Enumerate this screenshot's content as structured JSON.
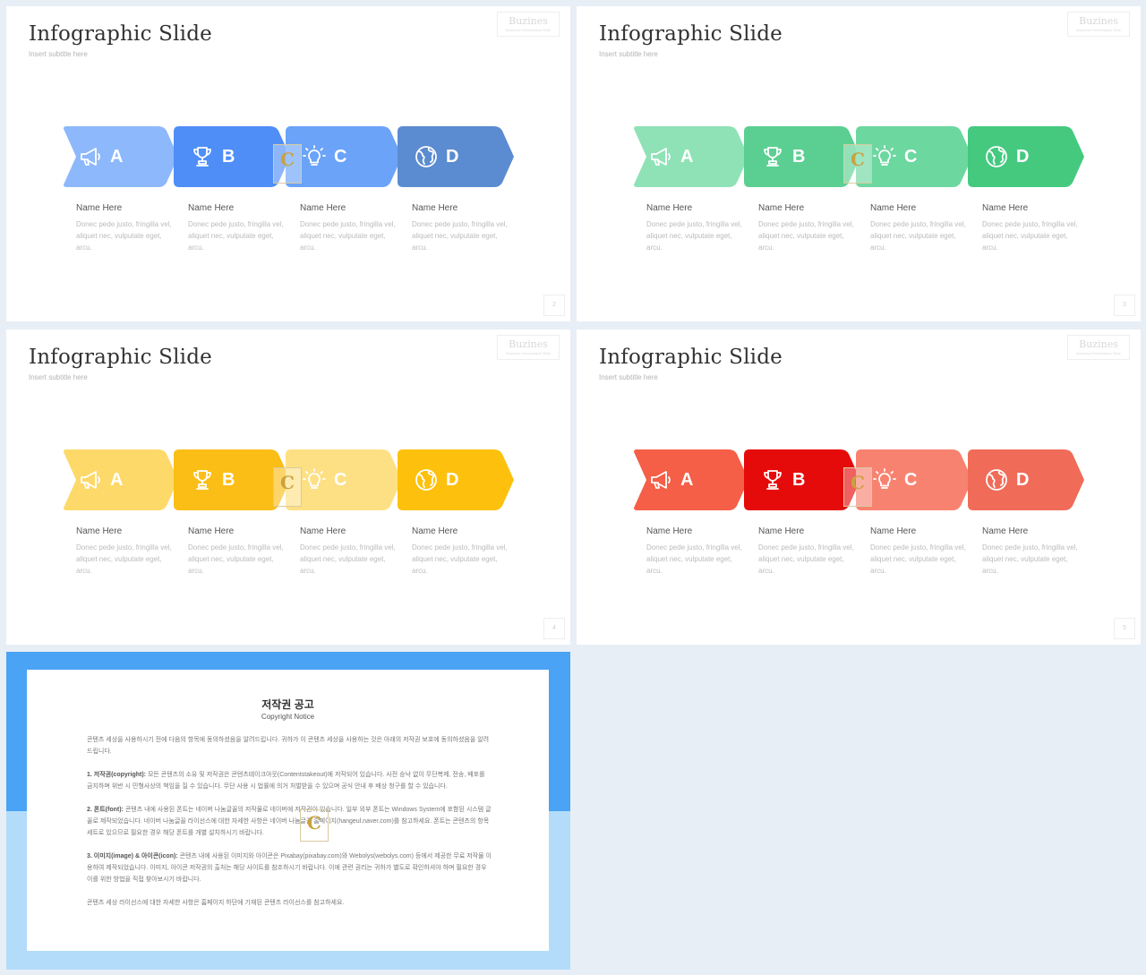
{
  "slides": [
    {
      "title": "Infographic Slide",
      "subtitle": "Insert subtitle here",
      "logo": {
        "name": "Buzines",
        "tagline": "Business Presentation Slide"
      },
      "page_number": "2",
      "colors": [
        "#8db8fb",
        "#4f8ef7",
        "#6aa3f8",
        "#5b8bd0"
      ],
      "items": [
        {
          "letter": "A",
          "icon": "megaphone-icon",
          "name": "Name Here",
          "desc": "Donec pede justo, fringilla vel, aliquet nec, vulputate eget, arcu."
        },
        {
          "letter": "B",
          "icon": "trophy-icon",
          "name": "Name Here",
          "desc": "Donec pede justo, fringilla vel, aliquet nec, vulputate eget, arcu."
        },
        {
          "letter": "C",
          "icon": "lightbulb-icon",
          "name": "Name Here",
          "desc": "Donec pede justo, fringilla vel, aliquet nec, vulputate eget, arcu."
        },
        {
          "letter": "D",
          "icon": "globe-icon",
          "name": "Name Here",
          "desc": "Donec pede justo, fringilla vel, aliquet nec, vulputate eget, arcu."
        }
      ]
    },
    {
      "title": "Infographic Slide",
      "subtitle": "Insert subtitle here",
      "logo": {
        "name": "Buzines",
        "tagline": "Business Presentation Slide"
      },
      "page_number": "3",
      "colors": [
        "#8fe2b6",
        "#5bcf92",
        "#6dd7a0",
        "#44c97f"
      ],
      "items": [
        {
          "letter": "A",
          "icon": "megaphone-icon",
          "name": "Name Here",
          "desc": "Donec pede justo, fringilla vel, aliquet nec, vulputate eget, arcu."
        },
        {
          "letter": "B",
          "icon": "trophy-icon",
          "name": "Name Here",
          "desc": "Donec pede justo, fringilla vel, aliquet nec, vulputate eget, arcu."
        },
        {
          "letter": "C",
          "icon": "lightbulb-icon",
          "name": "Name Here",
          "desc": "Donec pede justo, fringilla vel, aliquet nec, vulputate eget, arcu."
        },
        {
          "letter": "D",
          "icon": "globe-icon",
          "name": "Name Here",
          "desc": "Donec pede justo, fringilla vel, aliquet nec, vulputate eget, arcu."
        }
      ]
    },
    {
      "title": "Infographic Slide",
      "subtitle": "Insert subtitle here",
      "logo": {
        "name": "Buzines",
        "tagline": "Business Presentation Slide"
      },
      "page_number": "4",
      "colors": [
        "#fdd96a",
        "#fbbe17",
        "#fde084",
        "#fdc10d"
      ],
      "items": [
        {
          "letter": "A",
          "icon": "megaphone-icon",
          "name": "Name Here",
          "desc": "Donec pede justo, fringilla vel, aliquet nec, vulputate eget, arcu."
        },
        {
          "letter": "B",
          "icon": "trophy-icon",
          "name": "Name Here",
          "desc": "Donec pede justo, fringilla vel, aliquet nec, vulputate eget, arcu."
        },
        {
          "letter": "C",
          "icon": "lightbulb-icon",
          "name": "Name Here",
          "desc": "Donec pede justo, fringilla vel, aliquet nec, vulputate eget, arcu."
        },
        {
          "letter": "D",
          "icon": "globe-icon",
          "name": "Name Here",
          "desc": "Donec pede justo, fringilla vel, aliquet nec, vulputate eget, arcu."
        }
      ]
    },
    {
      "title": "Infographic Slide",
      "subtitle": "Insert subtitle here",
      "logo": {
        "name": "Buzines",
        "tagline": "Business Presentation Slide"
      },
      "page_number": "5",
      "colors": [
        "#f55e47",
        "#e60b0b",
        "#f88270",
        "#f06c58"
      ],
      "items": [
        {
          "letter": "A",
          "icon": "megaphone-icon",
          "name": "Name Here",
          "desc": "Donec pede justo, fringilla vel, aliquet nec, vulputate eget, arcu."
        },
        {
          "letter": "B",
          "icon": "trophy-icon",
          "name": "Name Here",
          "desc": "Donec pede justo, fringilla vel, aliquet nec, vulputate eget, arcu."
        },
        {
          "letter": "C",
          "icon": "lightbulb-icon",
          "name": "Name Here",
          "desc": "Donec pede justo, fringilla vel, aliquet nec, vulputate eget, arcu."
        },
        {
          "letter": "D",
          "icon": "globe-icon",
          "name": "Name Here",
          "desc": "Donec pede justo, fringilla vel, aliquet nec, vulputate eget, arcu."
        }
      ]
    }
  ],
  "watermark": {
    "letter": "C"
  },
  "notice": {
    "title": "저작권 공고",
    "subtitle": "Copyright Notice",
    "paragraphs": [
      {
        "heading": "",
        "text": "콘텐츠 세상을 사용하시기 전에 다음의 항목에 동의하셨음을 알려드립니다. 귀하가 이 콘텐츠 세상을 사용하는 것은 아래의 저작권 보호에 동의하셨음을 알려드립니다."
      },
      {
        "heading": "1. 저작권(copyright):",
        "text": "모든 콘텐츠의 소유 및 저작권은 콘텐츠테이크아웃(Contentstakeout)에 저작되어 있습니다. 사전 승낙 없이 무단복제, 전송, 배포를 금지하며 위반 시 민형사상의 책임을 질 수 있습니다. 무단 사용 시 법률에 의거 처벌받을 수 있으며 공식 안내 후 배상 청구를 할 수 있습니다."
      },
      {
        "heading": "2. 폰트(font):",
        "text": "콘텐츠 내에 사용된 폰트는 네이버 나눔글꼴의 저작물로 네이버에 저작권이 있습니다. 일부 외부 폰트는 Windows System에 포함된 시스템 글꼴로 제작되었습니다. 네이버 나눔글꼴 라이선스에 대한 자세한 사항은 네이버 나눔글꼴 홈페이지(hangeul.naver.com)를 참고하세요. 폰트는 콘텐츠의 항목 세트로 있으므로 필요한 경우 해당 폰트를 개별 설치하시기 바랍니다."
      },
      {
        "heading": "3. 이미지(image) & 아이콘(icon):",
        "text": "콘텐츠 내에 사용된 이미지와 아이콘은 Pixabay(pixabay.com)와 Webolys(webolys.com) 등에서 제공한 무료 저작물 이용하여 제작되었습니다. 이미지, 아이콘 저작권의 출처는 해당 사이트를 참조하시기 바랍니다. 이에 관련 권리는 귀하가 별도로 확인하셔야 하며 필요한 경우 이를 위한 방법을 직접 찾아보시기 바랍니다."
      },
      {
        "heading": "",
        "text": "콘텐츠 세상 라이선스에 대한 자세한 사항은 홈페이지 하단에 기재된 콘텐츠 라이선스를 참고하세요."
      }
    ]
  }
}
